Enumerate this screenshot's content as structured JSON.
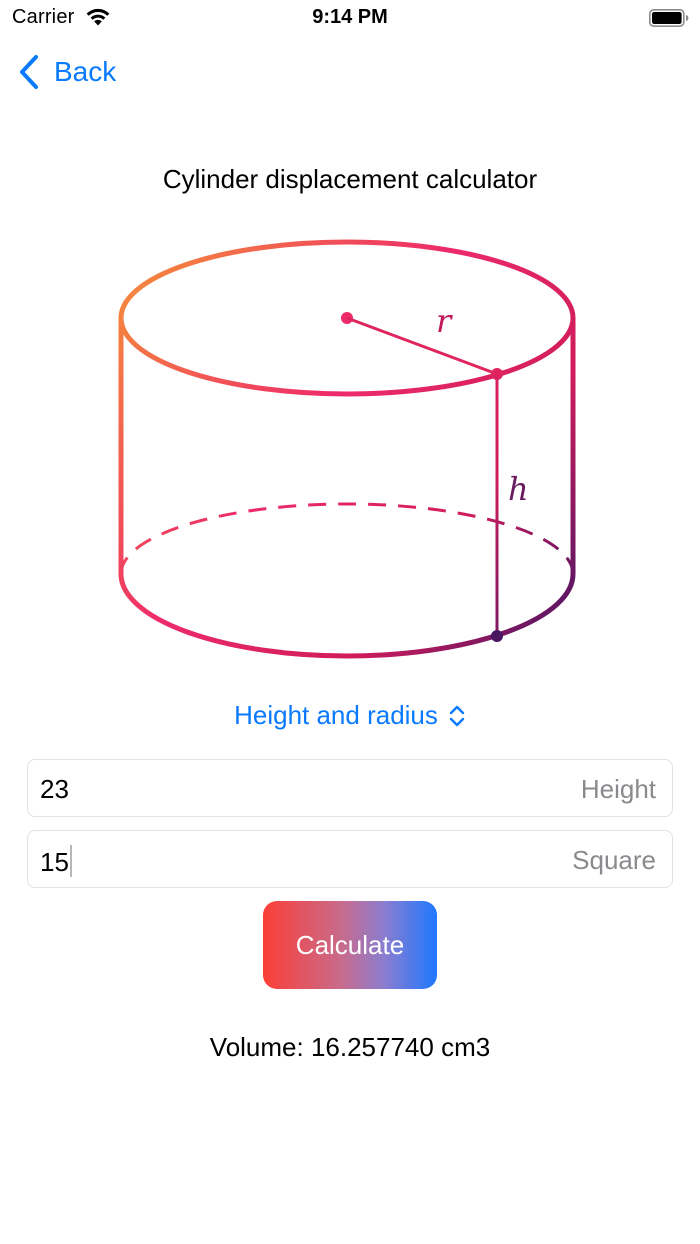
{
  "status_bar": {
    "carrier": "Carrier",
    "time": "9:14 PM"
  },
  "nav": {
    "back_label": "Back"
  },
  "title": "Cylinder displacement calculator",
  "diagram": {
    "radius_label": "r",
    "height_label": "h",
    "gradient": [
      "#f58a3c",
      "#ee2b6a",
      "#d01c5c",
      "#3a1466"
    ]
  },
  "mode_picker": {
    "selected": "Height and radius"
  },
  "inputs": {
    "height": {
      "value": "23",
      "placeholder": "Height"
    },
    "second": {
      "value": "15",
      "placeholder": "Square"
    }
  },
  "calculate_label": "Calculate",
  "result": "Volume: 16.257740 cm3",
  "colors": {
    "accent": "#0a7aff",
    "button_gradient_start": "#fb3f36",
    "button_gradient_end": "#1e78ff"
  }
}
